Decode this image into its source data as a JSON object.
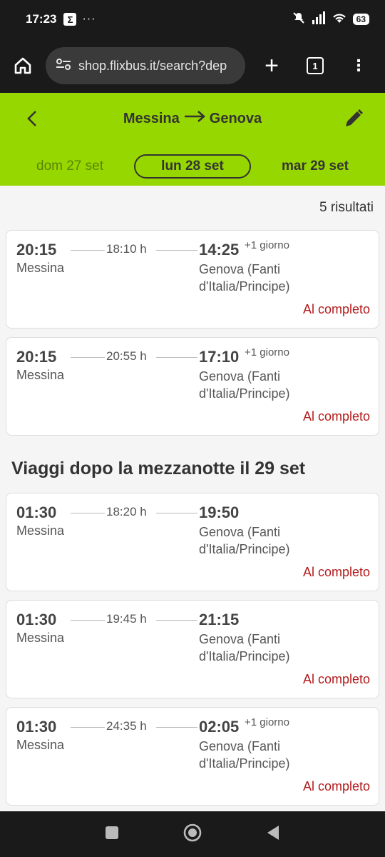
{
  "status_bar": {
    "time": "17:23",
    "notif_glyph": "Σ",
    "more": "···",
    "battery": "63"
  },
  "browser": {
    "url": "shop.flixbus.it/search?dep",
    "tab_count": "1"
  },
  "header": {
    "from": "Messina",
    "to": "Genova",
    "dates": {
      "prev": "dom 27 set",
      "current": "lun 28 set",
      "next": "mar 29 set"
    },
    "accent": "#97d700"
  },
  "results": {
    "count": "5 risultati",
    "trips": [
      {
        "dep_time": "20:15",
        "duration": "18:10 h",
        "arr_time": "14:25",
        "next_day": "+1 giorno",
        "dep_city": "Messina",
        "arr_city": "Genova (Fanti d'Italia/Principe)",
        "status": "Al completo"
      },
      {
        "dep_time": "20:15",
        "duration": "20:55 h",
        "arr_time": "17:10",
        "next_day": "+1 giorno",
        "dep_city": "Messina",
        "arr_city": "Genova (Fanti d'Italia/Principe)",
        "status": "Al completo"
      }
    ],
    "after_midnight_title": "Viaggi dopo la mezzanotte il 29 set",
    "after_midnight_trips": [
      {
        "dep_time": "01:30",
        "duration": "18:20 h",
        "arr_time": "19:50",
        "next_day": "",
        "dep_city": "Messina",
        "arr_city": "Genova (Fanti d'Italia/Principe)",
        "status": "Al completo"
      },
      {
        "dep_time": "01:30",
        "duration": "19:45 h",
        "arr_time": "21:15",
        "next_day": "",
        "dep_city": "Messina",
        "arr_city": "Genova (Fanti d'Italia/Principe)",
        "status": "Al completo"
      },
      {
        "dep_time": "01:30",
        "duration": "24:35 h",
        "arr_time": "02:05",
        "next_day": "+1 giorno",
        "dep_city": "Messina",
        "arr_city": "Genova (Fanti d'Italia/Principe)",
        "status": "Al completo"
      }
    ]
  }
}
